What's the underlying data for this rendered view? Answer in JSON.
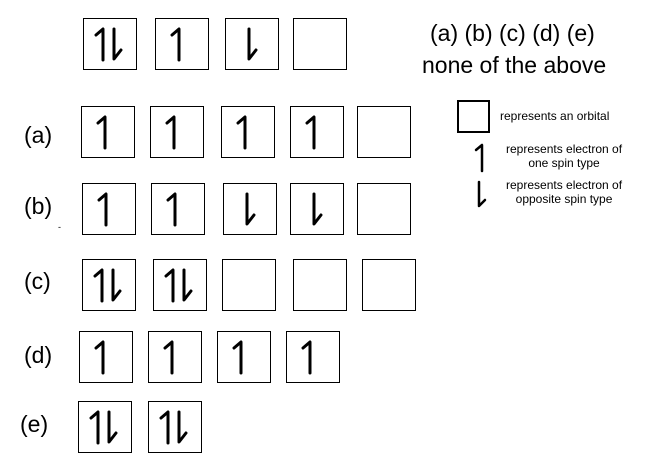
{
  "question": {
    "choices_line": "(a)  (b) (c) (d) (e)",
    "none_option": "none of the above"
  },
  "reference": {
    "orbitals": [
      "pair",
      "up",
      "down",
      "empty"
    ]
  },
  "options": [
    {
      "label": "(a)",
      "orbitals": [
        "up",
        "up",
        "up",
        "up",
        "empty"
      ]
    },
    {
      "label": "(b)",
      "orbitals": [
        "up",
        "up",
        "down",
        "down",
        "empty"
      ]
    },
    {
      "label": "(c)",
      "orbitals": [
        "pair",
        "pair",
        "empty",
        "empty",
        "empty"
      ]
    },
    {
      "label": "(d)",
      "orbitals": [
        "up",
        "up",
        "up",
        "up"
      ]
    },
    {
      "label": "(e)",
      "orbitals": [
        "pair",
        "pair"
      ]
    }
  ],
  "legend": {
    "orbital_text": "represents an orbital",
    "spin_up_text_1": "represents electron of",
    "spin_up_text_2": "one spin type",
    "spin_down_text_1": "represents electron of",
    "spin_down_text_2": "opposite spin type"
  },
  "stray_mark": "-"
}
